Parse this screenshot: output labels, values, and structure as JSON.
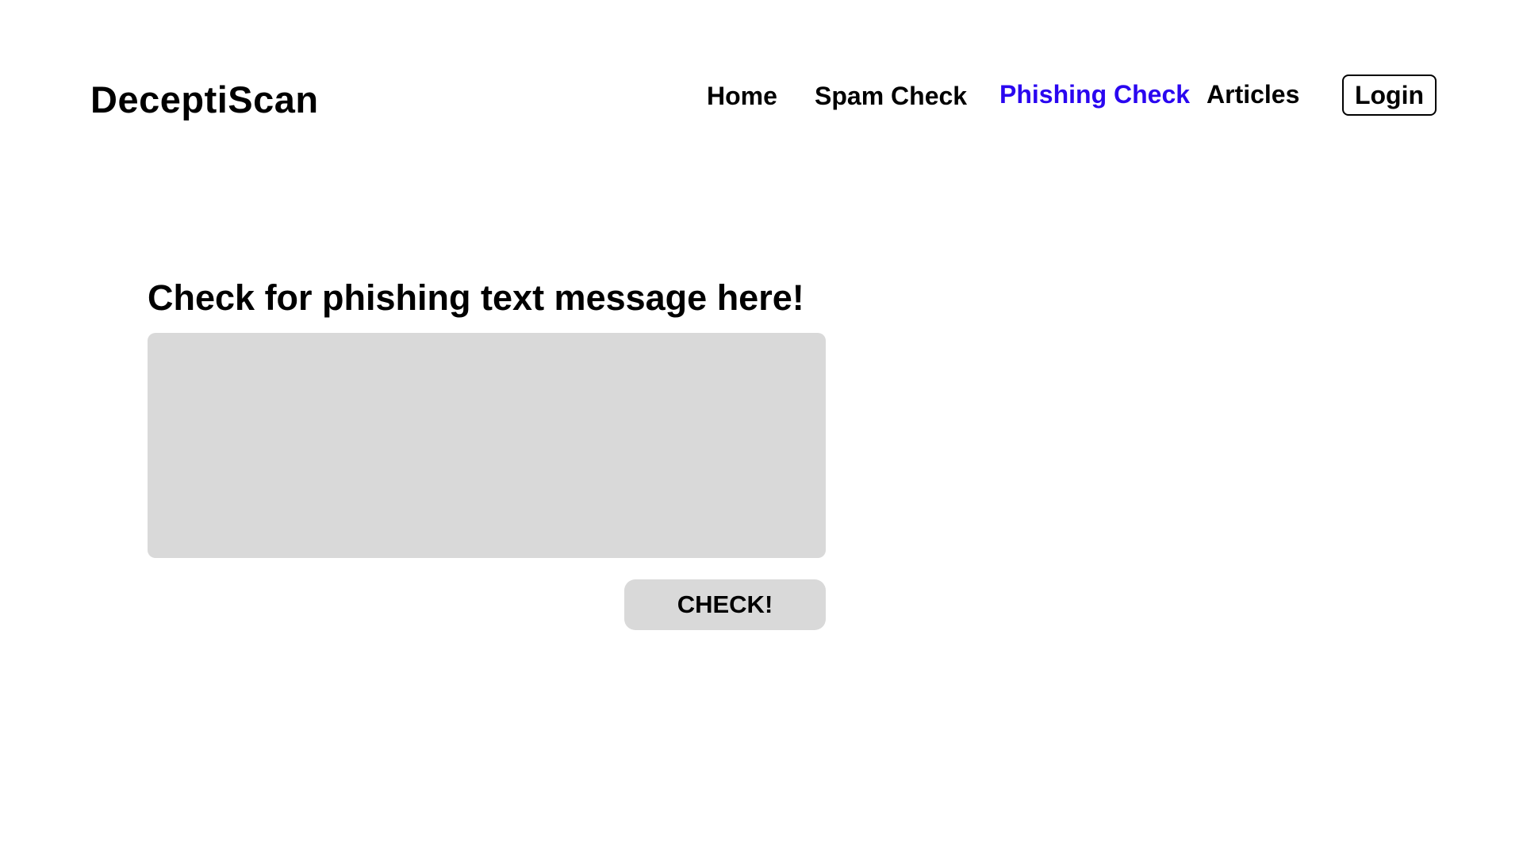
{
  "header": {
    "logo": "DeceptiScan",
    "nav": {
      "home": "Home",
      "spam_check": "Spam Check",
      "phishing_check": "Phishing Check",
      "articles": "Articles"
    },
    "login_label": "Login",
    "active_color": "#2a06f0"
  },
  "main": {
    "heading": "Check for phishing text message here!",
    "message_input": {
      "value": "",
      "placeholder": ""
    },
    "check_button_label": "CHECK!",
    "input_color": "#d9d9d9"
  }
}
